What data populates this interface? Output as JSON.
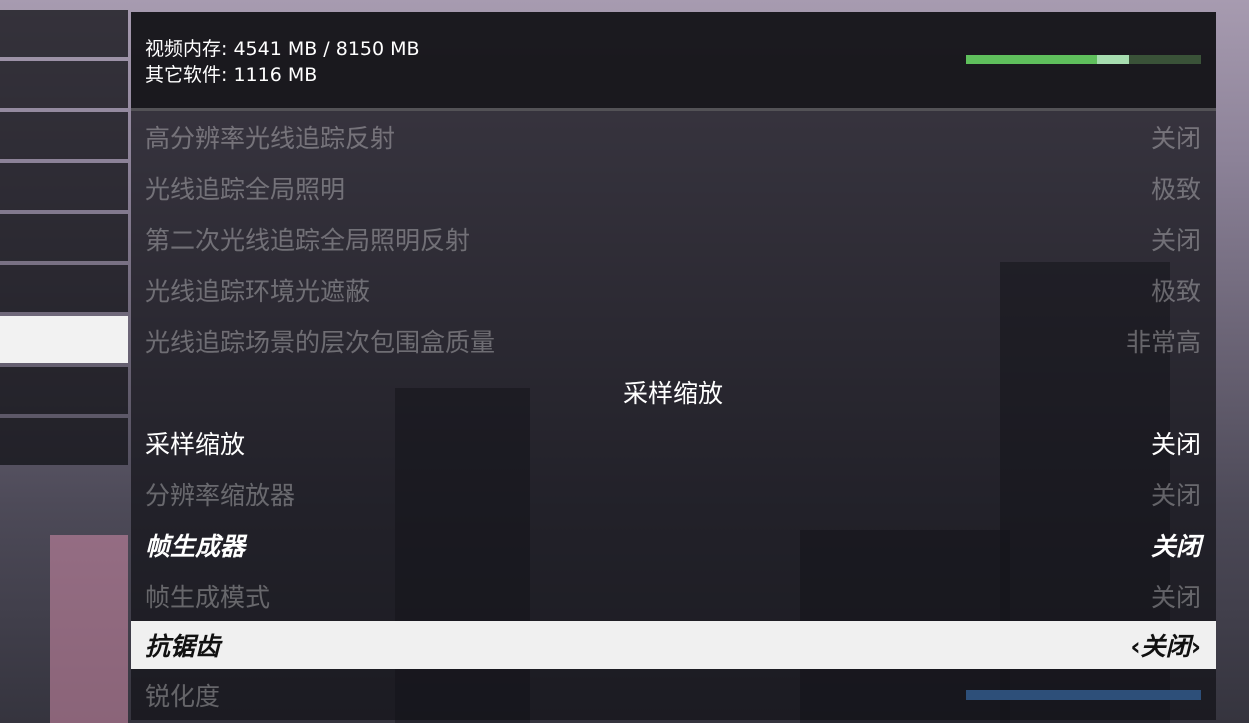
{
  "memory": {
    "video_memory": "视频内存: 4541 MB / 8150 MB",
    "other_software": "其它软件: 1116 MB",
    "used_fraction": 0.557,
    "other_fraction": 0.137
  },
  "left_nav": {
    "item_count": 9,
    "active_index": 6
  },
  "settings": [
    {
      "label": "高分辨率光线追踪反射",
      "value": "关闭",
      "style": "dim"
    },
    {
      "label": "光线追踪全局照明",
      "value": "极致",
      "style": "dim"
    },
    {
      "label": "第二次光线追踪全局照明反射",
      "value": "关闭",
      "style": "dim"
    },
    {
      "label": "光线追踪环境光遮蔽",
      "value": "极致",
      "style": "dim"
    },
    {
      "label": "光线追踪场景的层次包围盒质量",
      "value": "非常高",
      "style": "dim"
    },
    {
      "label": "采样缩放",
      "value": "",
      "style": "header"
    },
    {
      "label": "采样缩放",
      "value": "关闭",
      "style": "normal"
    },
    {
      "label": "分辨率缩放器",
      "value": "关闭",
      "style": "dim"
    },
    {
      "label": "帧生成器",
      "value": "关闭",
      "style": "bold"
    },
    {
      "label": "帧生成模式",
      "value": "关闭",
      "style": "dim"
    },
    {
      "label": "抗锯齿",
      "value": "关闭",
      "style": "selected",
      "arrow_left": "‹",
      "arrow_right": "›"
    },
    {
      "label": "锐化度",
      "value": "",
      "style": "dim",
      "slider": true
    }
  ],
  "colors": {
    "memory_used": "#5fbf5c",
    "memory_other": "#a7ddb0",
    "slider": "#2d4f79",
    "selected_row": "#f0f0f0"
  }
}
